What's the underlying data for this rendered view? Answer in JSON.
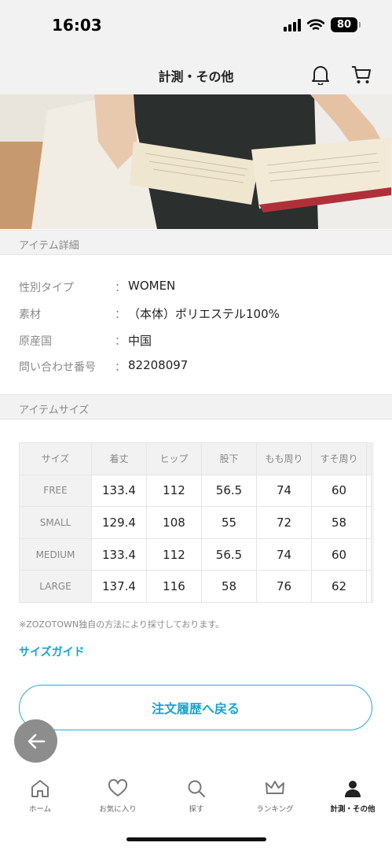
{
  "status_bar": {
    "time": "16:03",
    "battery": "80"
  },
  "header": {
    "title": "計測・その他"
  },
  "item_details": {
    "section_title": "アイテム詳細",
    "rows": [
      {
        "label": "性別タイプ",
        "colon": "：",
        "value": "WOMEN"
      },
      {
        "label": "素材",
        "colon": "：",
        "value": "（本体）ポリエステル100%"
      },
      {
        "label": "原産国",
        "colon": "：",
        "value": "中国"
      },
      {
        "label": "問い合わせ番号",
        "colon": "：",
        "value": "82208097"
      }
    ]
  },
  "item_size": {
    "section_title": "アイテムサイズ",
    "columns": [
      "サイズ",
      "着丈",
      "ヒップ",
      "股下",
      "もも周り",
      "すそ周り"
    ],
    "rows": [
      [
        "FREE",
        "133.4",
        "112",
        "56.5",
        "74",
        "60"
      ],
      [
        "SMALL",
        "129.4",
        "108",
        "55",
        "72",
        "58"
      ],
      [
        "MEDIUM",
        "133.4",
        "112",
        "56.5",
        "74",
        "60"
      ],
      [
        "LARGE",
        "137.4",
        "116",
        "58",
        "76",
        "62"
      ]
    ],
    "note": "※ZOZOTOWN独自の方法により採寸しております。",
    "size_guide_label": "サイズガイド"
  },
  "back_button_label": "注文履歴へ戻る",
  "tab_bar": {
    "items": [
      {
        "label": "ホーム",
        "icon": "home-icon"
      },
      {
        "label": "お気に入り",
        "icon": "heart-icon"
      },
      {
        "label": "探す",
        "icon": "search-icon"
      },
      {
        "label": "ランキング",
        "icon": "crown-icon"
      },
      {
        "label": "計測・その他",
        "icon": "person-icon",
        "active": true
      }
    ]
  },
  "colors": {
    "accent": "#1aa3cf",
    "section_bg": "#f2f2f2",
    "fab": "#8d8d8d"
  }
}
